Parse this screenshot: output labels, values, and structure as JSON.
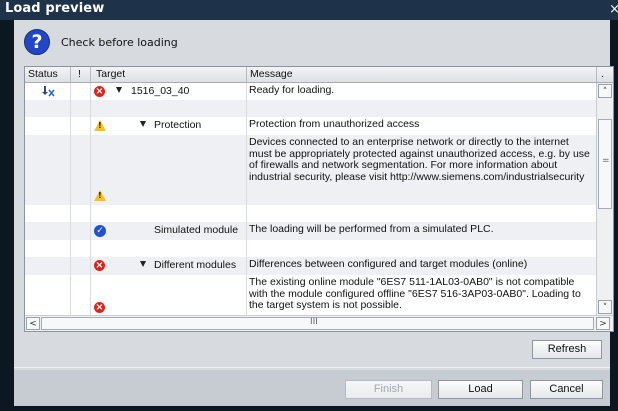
{
  "window": {
    "title": "Load preview",
    "close_label": "×"
  },
  "header": {
    "icon": "question-icon",
    "icon_glyph": "?",
    "text": "Check before loading"
  },
  "columns": {
    "status": "Status",
    "flag": "!",
    "target": "Target",
    "message": "Message",
    "extra": "."
  },
  "rows": [
    {
      "status_icon": "download-delete-icon",
      "flag_icon": "error-icon",
      "expanded": true,
      "target": "1516_03_40",
      "message": "Ready for loading."
    },
    {
      "flag_icon": "",
      "target": "",
      "message": ""
    },
    {
      "flag_icon": "warning-icon",
      "expanded": true,
      "target": "Protection",
      "message": "Protection from unauthorized access"
    },
    {
      "flag_icon": "warning-icon",
      "target": "",
      "message": "Devices connected to an enterprise network or directly to the internet must be appropriately protected against unauthorized access, e.g. by use of firewalls and network segmentation. For more information about industrial security, please visit http://www.siemens.com/industrialsecurity"
    },
    {
      "flag_icon": "",
      "target": "",
      "message": ""
    },
    {
      "flag_icon": "ok-icon",
      "target": "Simulated module",
      "message": "The loading will be performed from a simulated PLC."
    },
    {
      "flag_icon": "",
      "target": "",
      "message": ""
    },
    {
      "flag_icon": "error-icon",
      "expanded": true,
      "target": "Different modules",
      "message": "Differences between configured and target modules (online)"
    },
    {
      "flag_icon": "error-icon",
      "target": "",
      "message": "The existing online module \"6ES7 511-1AL03-0AB0\" is not compatible with the module configured offline \"6ES7 516-3AP03-0AB0\". Loading to the target system is not possible."
    }
  ],
  "scroll": {
    "up": "˄",
    "down": "˅",
    "left": "<",
    "right": ">",
    "grip_v": "=",
    "grip_h": "III"
  },
  "buttons": {
    "refresh": "Refresh",
    "finish": "Finish",
    "load": "Load",
    "cancel": "Cancel"
  }
}
